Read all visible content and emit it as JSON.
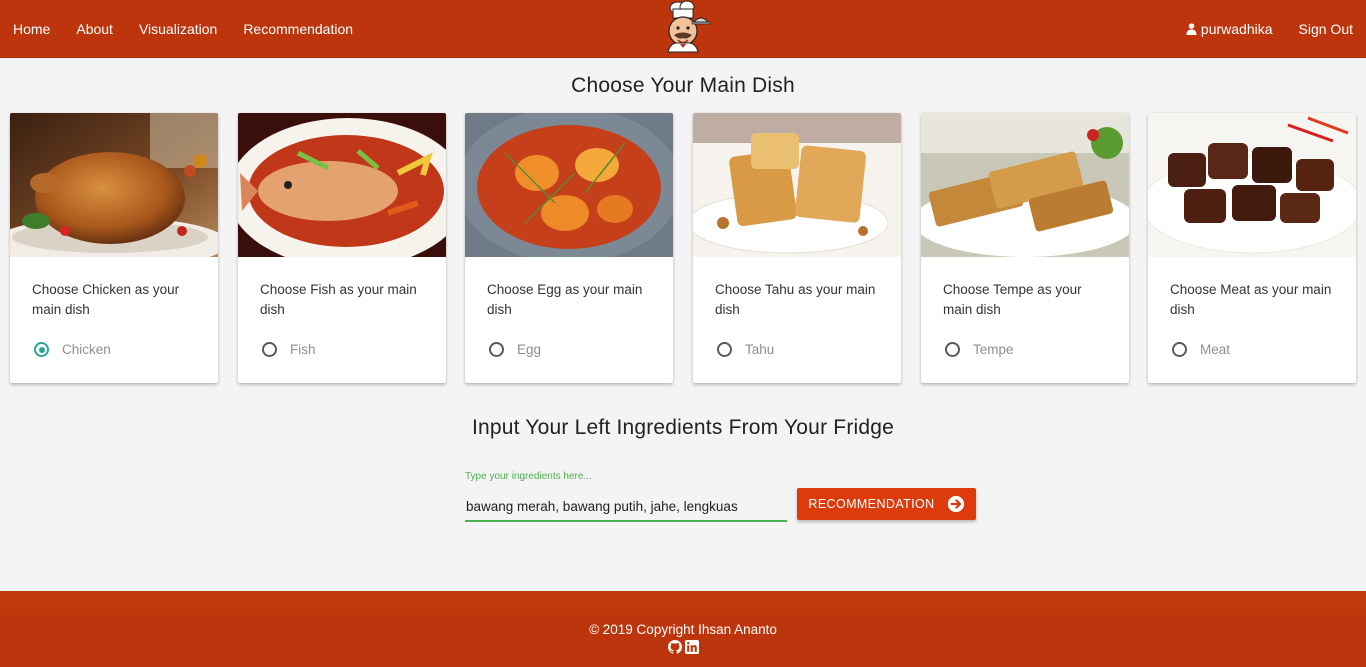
{
  "nav": {
    "links": [
      "Home",
      "About",
      "Visualization",
      "Recommendation"
    ],
    "user": "purwadhika",
    "signout": "Sign Out",
    "logo_icon": "chef-logo-icon",
    "user_icon": "user-icon"
  },
  "main": {
    "heading": "Choose Your Main Dish",
    "cards": [
      {
        "text": "Choose Chicken as your main dish",
        "option": "Chicken",
        "checked": true,
        "image_icon": "roast-chicken-image"
      },
      {
        "text": "Choose Fish as your main dish",
        "option": "Fish",
        "checked": false,
        "image_icon": "fish-dish-image"
      },
      {
        "text": "Choose Egg as your main dish",
        "option": "Egg",
        "checked": false,
        "image_icon": "egg-dish-image"
      },
      {
        "text": "Choose Tahu as your main dish",
        "option": "Tahu",
        "checked": false,
        "image_icon": "tahu-dish-image"
      },
      {
        "text": "Choose Tempe as your main dish",
        "option": "Tempe",
        "checked": false,
        "image_icon": "tempe-dish-image"
      },
      {
        "text": "Choose Meat as your main dish",
        "option": "Meat",
        "checked": false,
        "image_icon": "meat-dish-image"
      }
    ],
    "ingredients_heading": "Input Your Left Ingredients From Your Fridge",
    "input_label": "Type your ingredients here...",
    "input_value": "bawang merah, bawang putih, jahe, lengkuas",
    "button_label": "RECOMMENDATION",
    "button_icon": "arrow-right-circle-icon"
  },
  "footer": {
    "copyright": "© 2019 Copyright Ihsan Ananto",
    "icons": [
      "github-icon",
      "linkedin-icon"
    ]
  },
  "colors": {
    "brand": "#bd350c",
    "button": "#dd3b0b",
    "accent": "#26a69a",
    "input": "#4caf50"
  }
}
